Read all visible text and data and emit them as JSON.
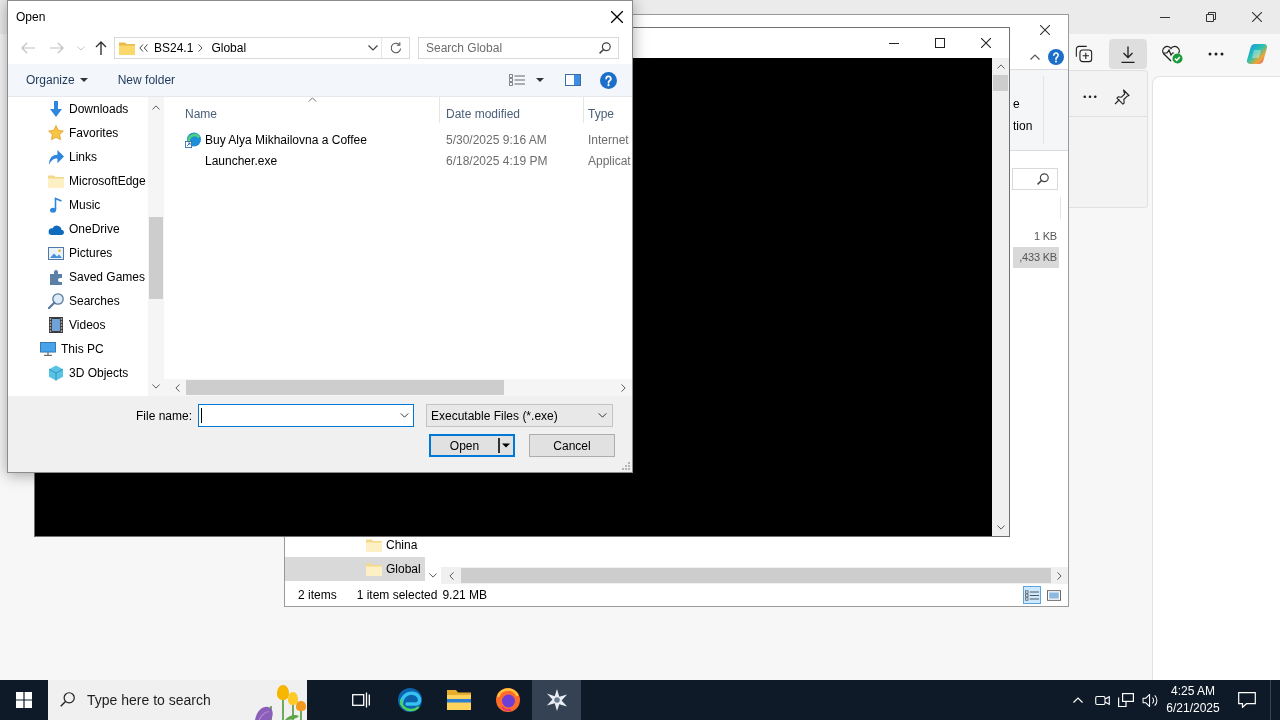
{
  "browser": {
    "toolbar": [
      {
        "kind": "collections",
        "selected": false
      },
      {
        "kind": "downloads",
        "selected": true
      },
      {
        "kind": "health",
        "selected": false
      },
      {
        "kind": "more",
        "selected": false
      },
      {
        "kind": "copilot",
        "selected": false
      }
    ]
  },
  "explorer": {
    "ribbon_label_fragments": [
      "e",
      "tion"
    ],
    "sizes": [
      {
        "text": "1 KB",
        "selected": false
      },
      {
        "text": ",433 KB",
        "selected": true
      }
    ],
    "nav_items": [
      {
        "label": "China",
        "selected": false
      },
      {
        "label": "Global",
        "selected": true
      }
    ],
    "status_bar": {
      "item_count": "2 items",
      "selection": "1 item selected",
      "size": "9.21 MB"
    },
    "view_buttons": [
      {
        "kind": "details",
        "selected": true
      },
      {
        "kind": "large_icons",
        "selected": false
      }
    ]
  },
  "dialog": {
    "title": "Open",
    "nav_buttons": [
      {
        "kind": "back",
        "disabled": true
      },
      {
        "kind": "forward",
        "disabled": true
      },
      {
        "kind": "recent",
        "disabled": true
      },
      {
        "kind": "up",
        "disabled": false
      }
    ],
    "breadcrumb": [
      "BS24.1",
      "Global"
    ],
    "search": {
      "placeholder": "Search Global"
    },
    "toolbar": {
      "organize": "Organize",
      "new_folder": "New folder"
    },
    "nav_tree": [
      {
        "label": "Downloads",
        "kind": "downloads"
      },
      {
        "label": "Favorites",
        "kind": "favorites"
      },
      {
        "label": "Links",
        "kind": "links"
      },
      {
        "label": "MicrosoftEdge",
        "kind": "folder"
      },
      {
        "label": "Music",
        "kind": "music"
      },
      {
        "label": "OneDrive",
        "kind": "onedrive"
      },
      {
        "label": "Pictures",
        "kind": "pictures"
      },
      {
        "label": "Saved Games",
        "kind": "saved_games"
      },
      {
        "label": "Searches",
        "kind": "searches"
      },
      {
        "label": "Videos",
        "kind": "videos"
      },
      {
        "label": "This PC",
        "kind": "pc",
        "children": [
          {
            "label": "3D Objects",
            "kind": "objects3d"
          }
        ]
      }
    ],
    "columns": [
      {
        "label": "Name",
        "sorted": true
      },
      {
        "label": "Date modified",
        "sorted": false
      },
      {
        "label": "Type",
        "sorted": false
      }
    ],
    "files": [
      {
        "kind": "shortcut",
        "name": "Buy Alya Mikhailovna a Coffee",
        "date": "5/30/2025 9:16 AM",
        "type": "Internet"
      },
      {
        "kind": "exe",
        "name": "Launcher.exe",
        "date": "6/18/2025 4:19 PM",
        "type": "Applicat"
      }
    ],
    "file_name": {
      "label": "File name:",
      "focused": true
    },
    "filter": "Executable Files (*.exe)",
    "buttons": [
      {
        "label": "Open",
        "kind": "split",
        "default": true
      },
      {
        "label": "Cancel",
        "kind": "plain",
        "default": false
      }
    ]
  },
  "taskbar": {
    "search_placeholder": "Type here to search",
    "apps": [
      {
        "kind": "task_view",
        "selected": false
      },
      {
        "kind": "edge",
        "selected": false
      },
      {
        "kind": "explorer",
        "selected": false
      },
      {
        "kind": "firefox",
        "selected": false
      },
      {
        "kind": "app",
        "selected": true
      }
    ],
    "time": "4:25 AM",
    "date": "6/21/2025"
  }
}
